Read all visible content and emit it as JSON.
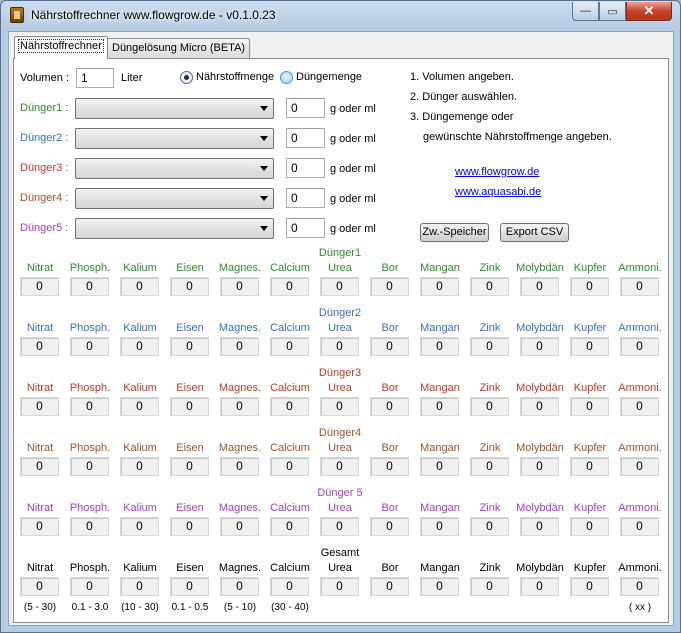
{
  "window": {
    "title": "Nährstoffrechner www.flowgrow.de - v0.1.0.23",
    "min_glyph": "—",
    "max_glyph": "▭",
    "close_glyph": "✕"
  },
  "tabs": [
    "Nährstoffrechner",
    "Düngelösung Micro (BETA)"
  ],
  "volume": {
    "label": "Volumen :",
    "value": "1",
    "unit": "Liter"
  },
  "mode": {
    "option_nutrient": "Nährstoffmenge",
    "option_fertilizer": "Düngemenge",
    "selected": "Nährstoffmenge"
  },
  "fertilizers": [
    {
      "label": "Dünger1 :",
      "amount": "0",
      "unit": "g oder ml",
      "color": "#2e8b2e"
    },
    {
      "label": "Dünger2 :",
      "amount": "0",
      "unit": "g oder ml",
      "color": "#3a6fc4"
    },
    {
      "label": "Dünger3 :",
      "amount": "0",
      "unit": "g oder ml",
      "color": "#c0392b"
    },
    {
      "label": "Dünger4 :",
      "amount": "0",
      "unit": "g oder ml",
      "color": "#a0522d"
    },
    {
      "label": "Dünger5 :",
      "amount": "0",
      "unit": "g oder ml",
      "color": "#a23fc0"
    }
  ],
  "instructions": [
    "1. Volumen angeben.",
    "2. Dünger auswählen.",
    "3. Düngemenge oder",
    "gewünschte Nährstoffmenge angeben."
  ],
  "links": [
    "www.flowgrow.de",
    "www.aquasabi.de"
  ],
  "buttons": {
    "store": "Zw.-Speicher",
    "export": "Export CSV"
  },
  "nutrient_labels": [
    "Nitrat",
    "Phosph.",
    "Kalium",
    "Eisen",
    "Magnes.",
    "Calcium",
    "Urea",
    "Bor",
    "Mangan",
    "Zink",
    "Molybdän",
    "Kupfer",
    "Ammoni."
  ],
  "groups": [
    {
      "title": "Dünger1",
      "color": "#2e8b2e",
      "values": [
        "0",
        "0",
        "0",
        "0",
        "0",
        "0",
        "0",
        "0",
        "0",
        "0",
        "0",
        "0",
        "0"
      ]
    },
    {
      "title": "Dünger2",
      "color": "#3a6fc4",
      "values": [
        "0",
        "0",
        "0",
        "0",
        "0",
        "0",
        "0",
        "0",
        "0",
        "0",
        "0",
        "0",
        "0"
      ]
    },
    {
      "title": "Dünger3",
      "color": "#c0392b",
      "values": [
        "0",
        "0",
        "0",
        "0",
        "0",
        "0",
        "0",
        "0",
        "0",
        "0",
        "0",
        "0",
        "0"
      ]
    },
    {
      "title": "Dünger4",
      "color": "#a0522d",
      "values": [
        "0",
        "0",
        "0",
        "0",
        "0",
        "0",
        "0",
        "0",
        "0",
        "0",
        "0",
        "0",
        "0"
      ]
    },
    {
      "title": "Dünger 5",
      "color": "#a23fc0",
      "values": [
        "0",
        "0",
        "0",
        "0",
        "0",
        "0",
        "0",
        "0",
        "0",
        "0",
        "0",
        "0",
        "0"
      ]
    },
    {
      "title": "Gesamt",
      "color": "#000000",
      "values": [
        "0",
        "0",
        "0",
        "0",
        "0",
        "0",
        "0",
        "0",
        "0",
        "0",
        "0",
        "0",
        "0"
      ]
    }
  ],
  "ranges": [
    "(5 - 30)",
    "0.1 - 3.0",
    "(10 - 30)",
    "0.1 - 0.5",
    "(5 - 10)",
    "(30 - 40)",
    "",
    "",
    "",
    "",
    "",
    "",
    "( xx )"
  ]
}
